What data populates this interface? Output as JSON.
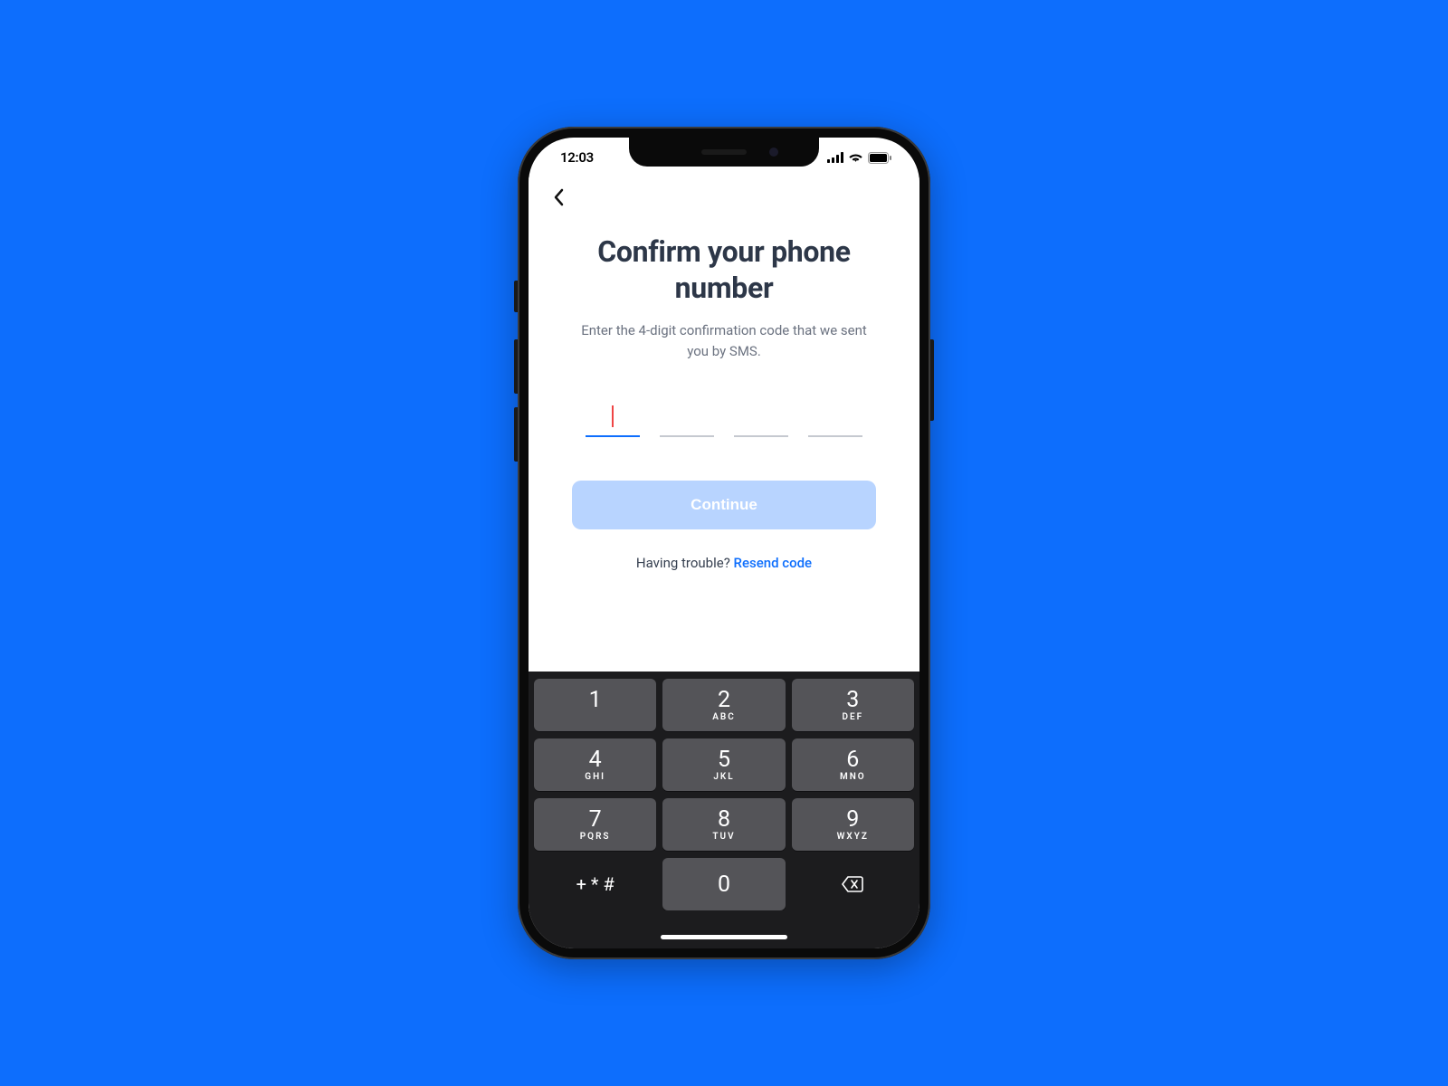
{
  "status": {
    "time": "12:03"
  },
  "page": {
    "title": "Confirm your phone number",
    "subtitle": "Enter the 4-digit confirmation code that we sent you by SMS."
  },
  "continue": {
    "label": "Continue"
  },
  "trouble": {
    "prompt": "Having trouble? ",
    "link": "Resend code"
  },
  "keypad": {
    "keys": [
      {
        "digit": "1",
        "letters": ""
      },
      {
        "digit": "2",
        "letters": "ABC"
      },
      {
        "digit": "3",
        "letters": "DEF"
      },
      {
        "digit": "4",
        "letters": "GHI"
      },
      {
        "digit": "5",
        "letters": "JKL"
      },
      {
        "digit": "6",
        "letters": "MNO"
      },
      {
        "digit": "7",
        "letters": "PQRS"
      },
      {
        "digit": "8",
        "letters": "TUV"
      },
      {
        "digit": "9",
        "letters": "WXYZ"
      },
      {
        "digit": "0",
        "letters": ""
      }
    ],
    "symbols": "+ * #"
  }
}
